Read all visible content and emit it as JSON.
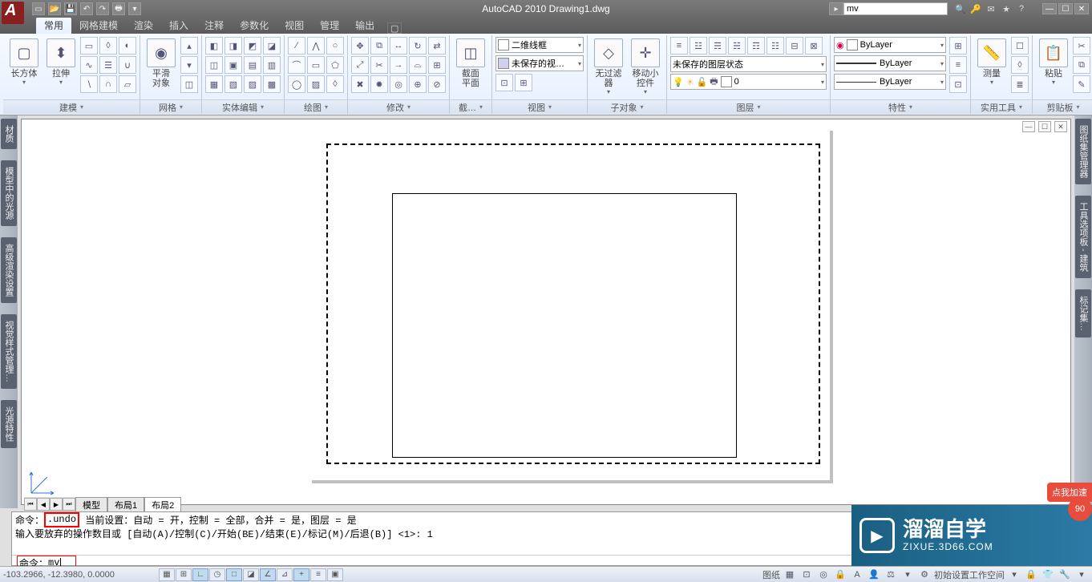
{
  "app": {
    "title": "AutoCAD 2010   Drawing1.dwg",
    "search_value": "mv"
  },
  "ribbon_tabs": [
    "常用",
    "网格建模",
    "渲染",
    "插入",
    "注释",
    "参数化",
    "视图",
    "管理",
    "输出"
  ],
  "active_tab": 0,
  "panels": {
    "modeling": {
      "title": "建模",
      "big1": "长方体",
      "big2": "拉伸",
      "big3": "平滑\n对象"
    },
    "mesh": {
      "title": "网格"
    },
    "solidedit": {
      "title": "实体编辑"
    },
    "draw": {
      "title": "绘图"
    },
    "modify": {
      "title": "修改"
    },
    "section": {
      "title": "截…",
      "big": "截面\n平面"
    },
    "view": {
      "title": "视图",
      "combo1": "二维线框",
      "combo2": "未保存的视…"
    },
    "subobj": {
      "title": "子对象",
      "big1": "无过滤器",
      "big2": "移动小控件"
    },
    "layers": {
      "title": "图层",
      "combo": "未保存的图层状态",
      "layer0": "0"
    },
    "props": {
      "title": "特性",
      "bylayer": "ByLayer"
    },
    "utils": {
      "title": "实用工具",
      "big": "测量"
    },
    "clip": {
      "title": "剪贴板",
      "big": "粘贴"
    }
  },
  "side_left": [
    "材质",
    "模型中的光源",
    "高级渲染设置",
    "视觉样式管理…",
    "光源特性"
  ],
  "side_right": [
    "图纸集管理器",
    "工具选项板 - 建筑",
    "标记集…"
  ],
  "layout_tabs": [
    "模型",
    "布局1",
    "布局2"
  ],
  "layout_active": 2,
  "cmd": {
    "hist1": "命令：",
    "hist1_boxed": ".undo",
    "hist1_rest": "当前设置：自动 = 开，控制 = 全部，合并 = 是，图层 = 是",
    "hist2": "输入要放弃的操作数目或 [自动(A)/控制(C)/开始(BE)/结束(E)/标记(M)/后退(B)] <1>: 1",
    "prompt": "命令：",
    "input": "mv"
  },
  "status": {
    "coords": "-103.2966, -12.3980, 0.0000",
    "paper_label": "图纸",
    "workspace": "初始设置工作空间"
  },
  "watermark": {
    "main": "溜溜自学",
    "sub": "ZIXUE.3D66.COM",
    "badge": "点我加速",
    "num": "90"
  }
}
